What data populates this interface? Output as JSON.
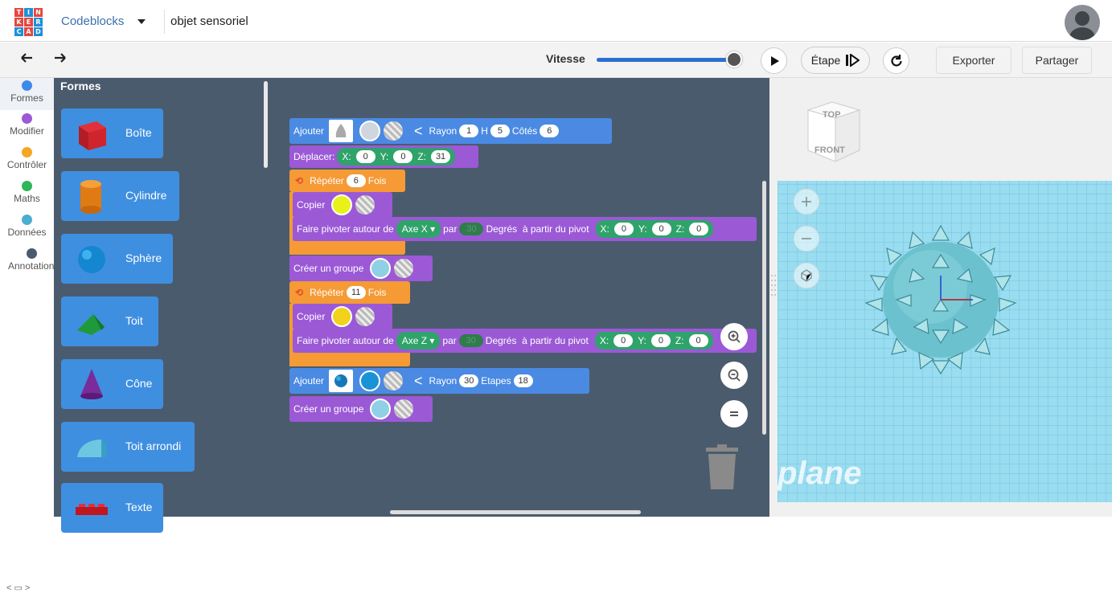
{
  "logo": {
    "letters": [
      "T",
      "I",
      "N",
      "K",
      "E",
      "R",
      "C",
      "A",
      "D"
    ]
  },
  "header": {
    "app_name": "Codeblocks",
    "project_name": "objet sensoriel"
  },
  "toolbar": {
    "undo_icon": "undo-arrow-icon",
    "redo_icon": "redo-arrow-icon",
    "speed_label": "Vitesse",
    "speed_level": 0.95,
    "step_label": "Étape",
    "export_label": "Exporter",
    "share_label": "Partager"
  },
  "categories": [
    {
      "label": "Formes",
      "color": "#3d8be8"
    },
    {
      "label": "Modifier",
      "color": "#9b59d6"
    },
    {
      "label": "Contrôler",
      "color": "#f5a623"
    },
    {
      "label": "Maths",
      "color": "#2fb55a"
    },
    {
      "label": "Données",
      "color": "#4aaed0"
    },
    {
      "label": "Annotation",
      "color": "#4b5b6e"
    }
  ],
  "palette": {
    "title": "Formes",
    "shapes": [
      "Boîte",
      "Cylindre",
      "Sphère",
      "Toit",
      "Cône",
      "Toit arrondi",
      "Texte"
    ]
  },
  "blocks": {
    "add1": {
      "label": "Ajouter",
      "rayon_label": "Rayon",
      "rayon": "1",
      "h_label": "H",
      "h": "5",
      "cotes_label": "Côtés",
      "cotes": "6"
    },
    "move": {
      "label": "Déplacer:",
      "x_label": "X:",
      "x": "0",
      "y_label": "Y:",
      "y": "0",
      "z_label": "Z:",
      "z": "31"
    },
    "repeat1": {
      "label": "Répéter",
      "count": "6",
      "suffix": "Fois"
    },
    "copy1": {
      "label": "Copier"
    },
    "rotate1": {
      "label": "Faire pivoter autour de",
      "axis": "Axe X",
      "par": "par",
      "deg": "30",
      "deg_label": "Degrés",
      "pivot_label": "à partir du pivot",
      "x_label": "X:",
      "x": "0",
      "y_label": "Y:",
      "y": "0",
      "z_label": "Z:",
      "z": "0"
    },
    "group1": {
      "label": "Créer un groupe"
    },
    "repeat2": {
      "label": "Répéter",
      "count": "11",
      "suffix": "Fois"
    },
    "copy2": {
      "label": "Copier"
    },
    "rotate2": {
      "label": "Faire pivoter autour de",
      "axis": "Axe Z",
      "par": "par",
      "deg": "30",
      "deg_label": "Degrés",
      "pivot_label": "à partir du pivot",
      "x_label": "X:",
      "x": "0",
      "y_label": "Y:",
      "y": "0",
      "z_label": "Z:",
      "z": "0"
    },
    "add2": {
      "label": "Ajouter",
      "rayon_label": "Rayon",
      "rayon": "30",
      "etapes_label": "Etapes",
      "etapes": "18"
    },
    "group2": {
      "label": "Créer un groupe"
    }
  },
  "viewcube": {
    "top": "TOP",
    "front": "FRONT"
  },
  "workplane_label": "plane",
  "colors": {
    "accent": "#3d8be8",
    "workspace": "#4b5b6e",
    "palette_block": "#3f8fe0",
    "grid": "#7fd3ea"
  }
}
